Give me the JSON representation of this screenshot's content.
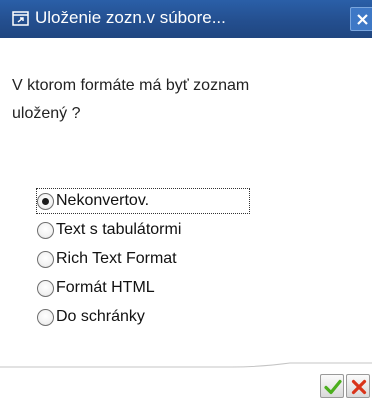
{
  "window": {
    "title": "Uloženie zozn.v súbore...",
    "title_icon": "external-window-icon",
    "close_icon": "close-icon",
    "title_bar_color": "#244f8f"
  },
  "question": "V ktorom formáte má byť zoznam uložený ?",
  "options": [
    {
      "label": "Nekonvertov.",
      "selected": true
    },
    {
      "label": "Text s tabulátormi",
      "selected": false
    },
    {
      "label": "Rich Text Format",
      "selected": false
    },
    {
      "label": "Formát HTML",
      "selected": false
    },
    {
      "label": "Do schránky",
      "selected": false
    }
  ],
  "buttons": {
    "ok_icon": "checkmark-icon",
    "ok_color": "#4caf1e",
    "cancel_icon": "cross-icon",
    "cancel_color": "#d9341a"
  }
}
